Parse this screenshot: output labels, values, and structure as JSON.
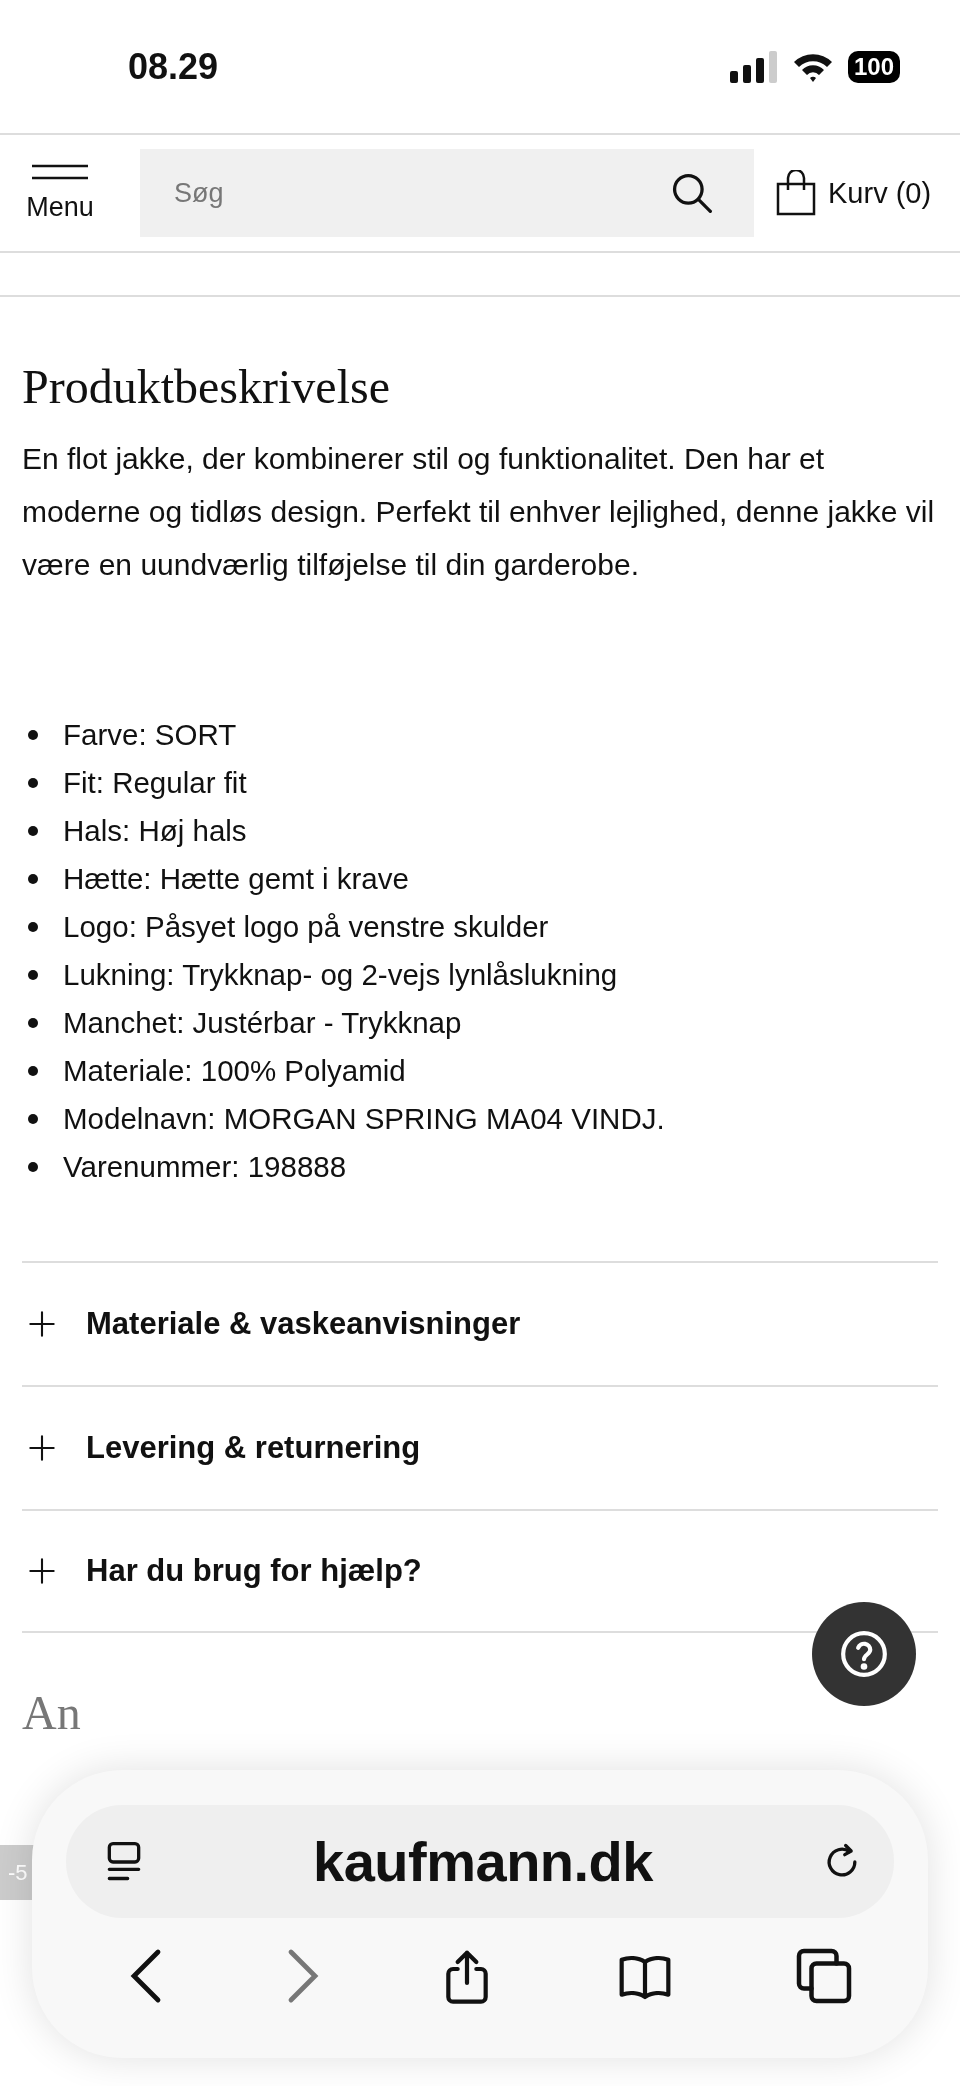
{
  "status_bar": {
    "time": "08.29",
    "battery": "100"
  },
  "header": {
    "menu_label": "Menu",
    "search": {
      "placeholder": "Søg"
    },
    "cart_label": "Kurv (0)"
  },
  "description": {
    "title": "Produktbeskrivelse",
    "text": "En flot jakke, der kombinerer stil og funktionalitet. Den har et moderne og tidløs design. Perfekt til enhver lejlighed, denne jakke vil være en uundværlig tilføjelse til din garderobe.",
    "specs": [
      "Farve: SORT",
      "Fit: Regular fit",
      "Hals: Høj hals",
      "Hætte: Hætte gemt i krave",
      "Logo: Påsyet logo på venstre skulder",
      "Lukning: Trykknap- og 2-vejs lynlåslukning",
      "Manchet: Justérbar - Trykknap",
      "Materiale: 100% Polyamid",
      "Modelnavn: MORGAN SPRING MA04 VINDJ.",
      "Varenummer: 198888"
    ]
  },
  "accordions": [
    {
      "label": "Materiale & vaskeanvisninger",
      "expanded": false
    },
    {
      "label": "Levering & returnering",
      "expanded": false
    },
    {
      "label": "Har du brug for hjælp?",
      "expanded": false
    }
  ],
  "next_section": {
    "title": "An",
    "badge": "-5"
  },
  "browser_toolbar": {
    "url": "kaufmann.dk",
    "back_disabled": false,
    "forward_disabled": true
  }
}
